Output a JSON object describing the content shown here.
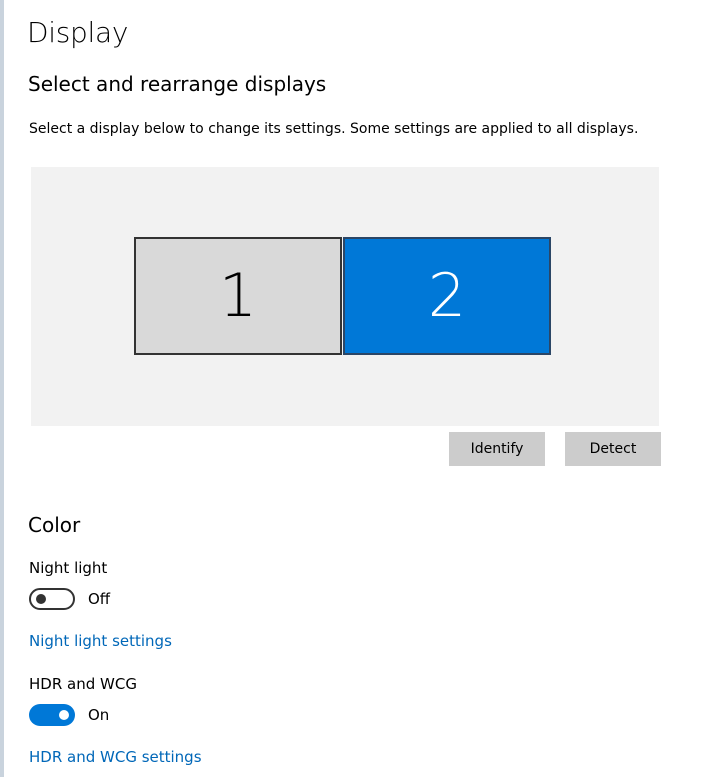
{
  "page": {
    "title": "Display"
  },
  "arrange": {
    "heading": "Select and rearrange displays",
    "description": "Select a display below to change its settings. Some settings are applied to all displays.",
    "displays": [
      {
        "number": "1",
        "selected": false,
        "color": "#d9d9d9"
      },
      {
        "number": "2",
        "selected": true,
        "color": "#0078d7"
      }
    ],
    "identify_label": "Identify",
    "detect_label": "Detect"
  },
  "color": {
    "heading": "Color",
    "night_light": {
      "label": "Night light",
      "state": "Off",
      "on": false,
      "settings_link": "Night light settings"
    },
    "hdr": {
      "label": "HDR and WCG",
      "state": "On",
      "on": true,
      "settings_link": "HDR and WCG settings"
    }
  },
  "colors": {
    "accent": "#0078d7",
    "link": "#0067b8",
    "button": "#cccccc",
    "panel": "#f2f2f2"
  }
}
